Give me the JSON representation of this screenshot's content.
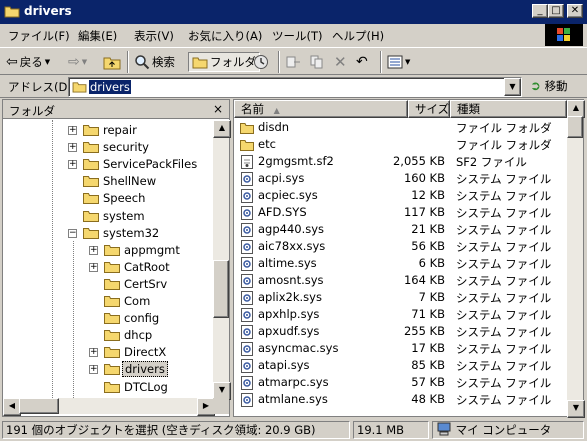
{
  "window": {
    "title": "drivers"
  },
  "menu": [
    "ファイル(F)",
    "編集(E)",
    "表示(V)",
    "お気に入り(A)",
    "ツール(T)",
    "ヘルプ(H)"
  ],
  "toolbar": {
    "back_label": "戻る",
    "search_label": "検索",
    "folders_label": "フォルダ"
  },
  "address": {
    "label": "アドレス(D)",
    "value": "drivers",
    "go_label": "移動"
  },
  "folder_pane": {
    "title": "フォルダ",
    "close": "×",
    "items": [
      {
        "label": "repair",
        "expander": "+"
      },
      {
        "label": "security",
        "expander": "+"
      },
      {
        "label": "ServicePackFiles",
        "expander": "+"
      },
      {
        "label": "ShellNew",
        "expander": ""
      },
      {
        "label": "Speech",
        "expander": ""
      },
      {
        "label": "system",
        "expander": ""
      },
      {
        "label": "system32",
        "expander": "−"
      },
      {
        "label": "appmgmt",
        "expander": "+"
      },
      {
        "label": "CatRoot",
        "expander": "+"
      },
      {
        "label": "CertSrv",
        "expander": ""
      },
      {
        "label": "Com",
        "expander": ""
      },
      {
        "label": "config",
        "expander": ""
      },
      {
        "label": "dhcp",
        "expander": ""
      },
      {
        "label": "DirectX",
        "expander": "+"
      },
      {
        "label": "drivers",
        "expander": "+"
      },
      {
        "label": "DTCLog",
        "expander": ""
      }
    ]
  },
  "file_list": {
    "columns": {
      "name": "名前",
      "size": "サイズ",
      "type": "種類"
    },
    "rows": [
      {
        "name": "disdn",
        "size": "",
        "type": "ファイル フォルダ",
        "icon": "folder-icon"
      },
      {
        "name": "etc",
        "size": "",
        "type": "ファイル フォルダ",
        "icon": "folder-icon"
      },
      {
        "name": "2gmgsmt.sf2",
        "size": "2,055 KB",
        "type": "SF2 ファイル",
        "icon": "sf2-file-icon"
      },
      {
        "name": "acpi.sys",
        "size": "160 KB",
        "type": "システム ファイル",
        "icon": "system-file-icon"
      },
      {
        "name": "acpiec.sys",
        "size": "12 KB",
        "type": "システム ファイル",
        "icon": "system-file-icon"
      },
      {
        "name": "AFD.SYS",
        "size": "117 KB",
        "type": "システム ファイル",
        "icon": "system-file-icon"
      },
      {
        "name": "agp440.sys",
        "size": "21 KB",
        "type": "システム ファイル",
        "icon": "system-file-icon"
      },
      {
        "name": "aic78xx.sys",
        "size": "56 KB",
        "type": "システム ファイル",
        "icon": "system-file-icon"
      },
      {
        "name": "altime.sys",
        "size": "6 KB",
        "type": "システム ファイル",
        "icon": "system-file-icon"
      },
      {
        "name": "amosnt.sys",
        "size": "164 KB",
        "type": "システム ファイル",
        "icon": "system-file-icon"
      },
      {
        "name": "aplix2k.sys",
        "size": "7 KB",
        "type": "システム ファイル",
        "icon": "system-file-icon"
      },
      {
        "name": "apxhlp.sys",
        "size": "71 KB",
        "type": "システム ファイル",
        "icon": "system-file-icon"
      },
      {
        "name": "apxudf.sys",
        "size": "255 KB",
        "type": "システム ファイル",
        "icon": "system-file-icon"
      },
      {
        "name": "asyncmac.sys",
        "size": "17 KB",
        "type": "システム ファイル",
        "icon": "system-file-icon"
      },
      {
        "name": "atapi.sys",
        "size": "85 KB",
        "type": "システム ファイル",
        "icon": "system-file-icon"
      },
      {
        "name": "atmarpc.sys",
        "size": "57 KB",
        "type": "システム ファイル",
        "icon": "system-file-icon"
      },
      {
        "name": "atmlane.sys",
        "size": "48 KB",
        "type": "システム ファイル",
        "icon": "system-file-icon"
      }
    ]
  },
  "status": {
    "objects": "191 個のオブジェクトを選択 (空きディスク領域: 20.9 GB)",
    "size": "19.1 MB",
    "location": "マイ コンピュータ"
  },
  "colors": {
    "title_bg": "#0a246a",
    "face": "#d4d0c8",
    "folder": "#f5d76e"
  }
}
